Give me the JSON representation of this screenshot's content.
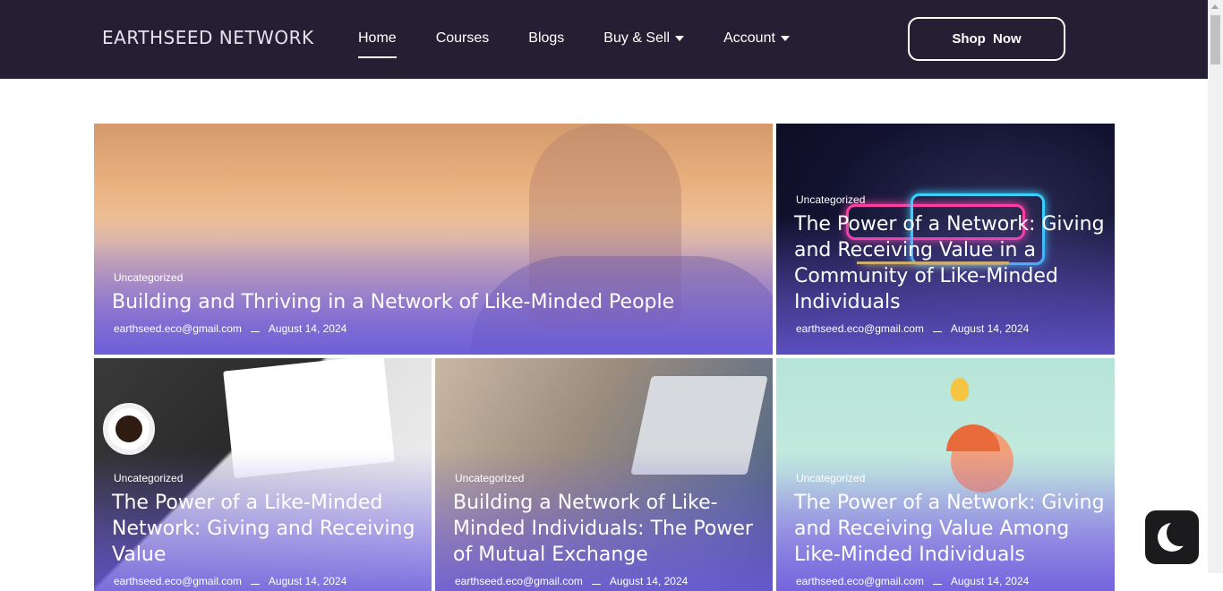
{
  "header": {
    "logo": "EARTHSEED NETWORK",
    "nav": [
      {
        "label": "Home",
        "active": true,
        "dropdown": false
      },
      {
        "label": "Courses",
        "active": false,
        "dropdown": false
      },
      {
        "label": "Blogs",
        "active": false,
        "dropdown": false
      },
      {
        "label": "Buy & Sell",
        "active": false,
        "dropdown": true
      },
      {
        "label": "Account",
        "active": false,
        "dropdown": true
      }
    ],
    "cta": "Shop Now"
  },
  "posts": [
    {
      "category": "Uncategorized",
      "title": "Building and Thriving in a Network of Like-Minded People",
      "author": "earthseed.eco@gmail.com",
      "date": "August 14, 2024"
    },
    {
      "category": "Uncategorized",
      "title": "The Power of a Network: Giving and Receiving Value in a Community of Like-Minded Individuals",
      "author": "earthseed.eco@gmail.com",
      "date": "August 14, 2024"
    },
    {
      "category": "Uncategorized",
      "title": "The Power of a Like-Minded Network: Giving and Receiving Value",
      "author": "earthseed.eco@gmail.com",
      "date": "August 14, 2024"
    },
    {
      "category": "Uncategorized",
      "title": "Building a Network of Like-Minded Individuals: The Power of Mutual Exchange",
      "author": "earthseed.eco@gmail.com",
      "date": "August 14, 2024"
    },
    {
      "category": "Uncategorized",
      "title": "The Power of a Network: Giving and Receiving Value Among Like-Minded Individuals",
      "author": "earthseed.eco@gmail.com",
      "date": "August 14, 2024"
    }
  ],
  "colors": {
    "header_bg": "#261f33",
    "card_overlay": "#6f5fe0",
    "toggle_bg": "#1b1b1d"
  },
  "icons": {
    "dark_mode_toggle": "moon-icon",
    "dropdown": "caret-down-icon"
  }
}
